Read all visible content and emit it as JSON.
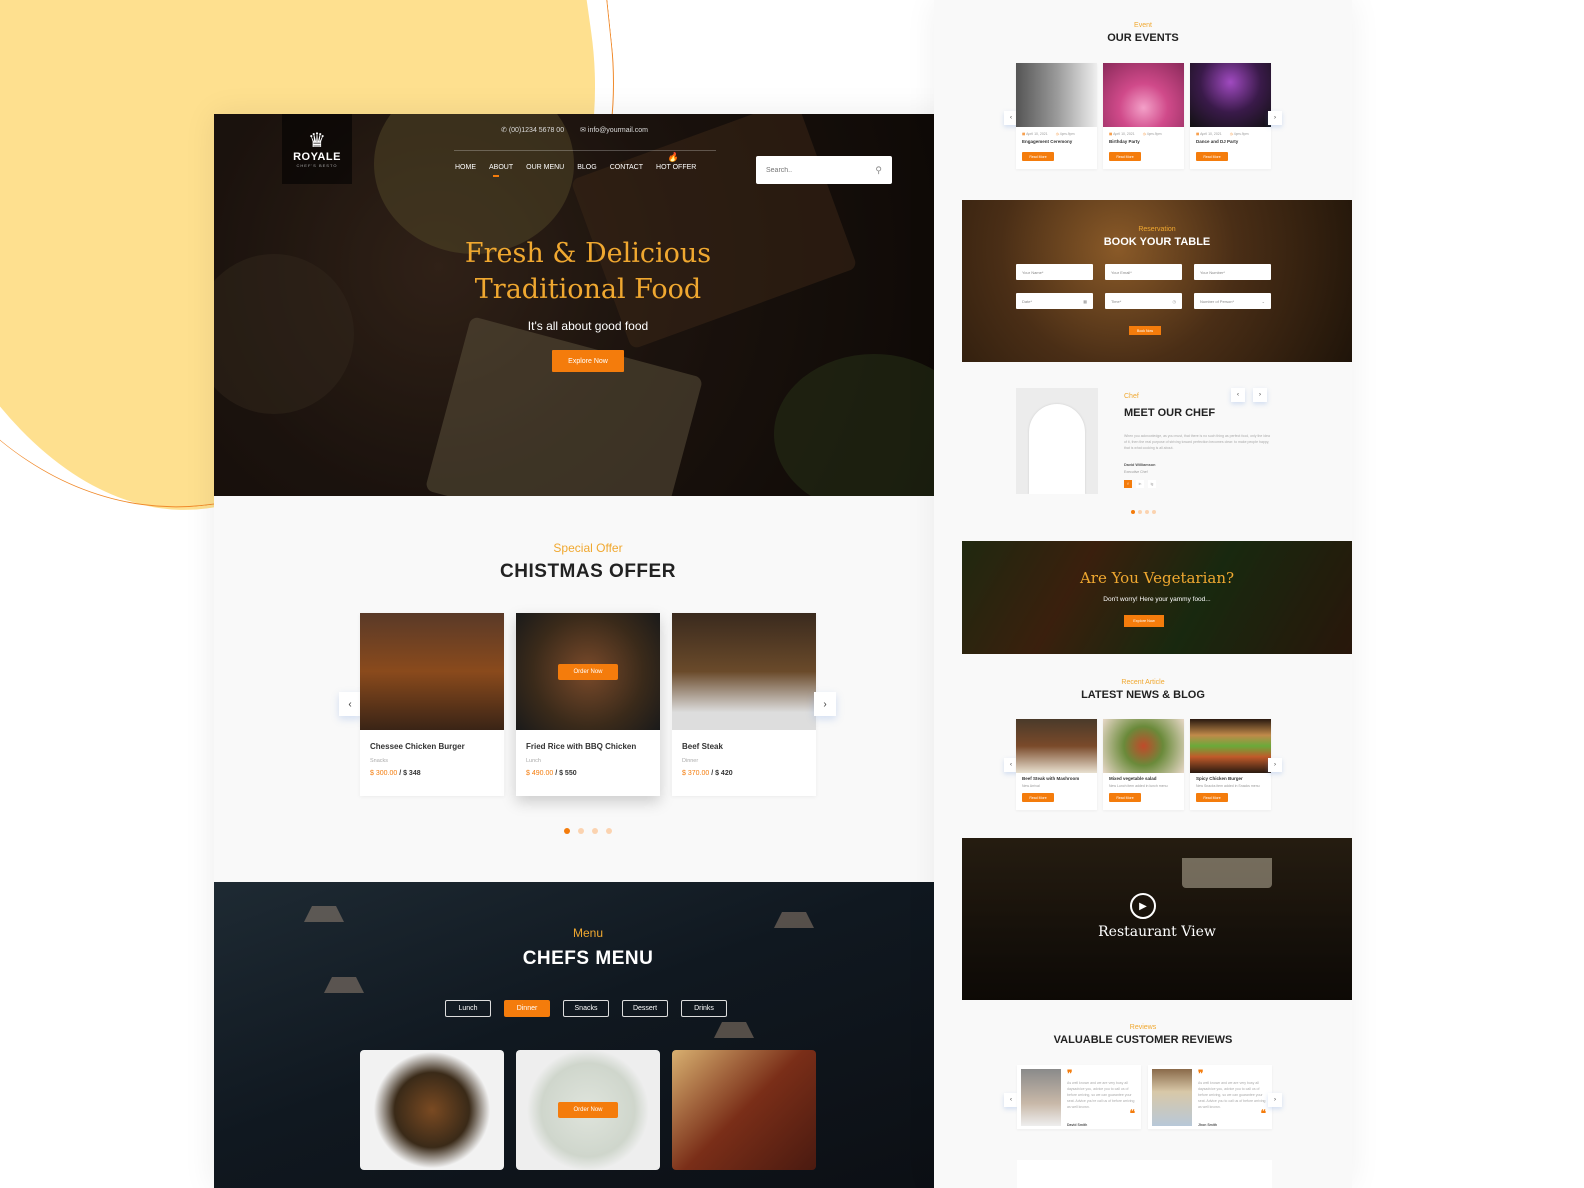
{
  "header": {
    "logo_name": "ROYALE",
    "logo_tagline": "CHEF'S BESTO",
    "phone": "(00)1234 5678 00",
    "email": "info@yourmail.com",
    "nav": [
      "HOME",
      "ABOUT",
      "OUR MENU",
      "BLOG",
      "CONTACT",
      "HOT OFFER"
    ],
    "active_nav": "ABOUT",
    "search_placeholder": "Search..",
    "icons": {
      "phone": "phone-icon",
      "email": "mail-icon",
      "search": "search-icon",
      "hot": "fire-icon"
    }
  },
  "hero": {
    "title_line1": "Fresh & Delicious",
    "title_line2": "Traditional Food",
    "subtitle": "It's all about good food",
    "cta": "Explore Now"
  },
  "offer": {
    "kicker": "Special Offer",
    "title": "CHISTMAS OFFER",
    "order_label": "Order Now",
    "items": [
      {
        "name": "Chessee Chicken Burger",
        "category": "Snacks",
        "price": "$ 300.00",
        "old_price": "$ 348"
      },
      {
        "name": "Fried Rice with BBQ Chicken",
        "category": "Lunch",
        "price": "$ 490.00",
        "old_price": "$ 550"
      },
      {
        "name": "Beef Steak",
        "category": "Dinner",
        "price": "$ 370.00",
        "old_price": "$ 420"
      }
    ],
    "pages": 4,
    "active_page": 1
  },
  "menu": {
    "kicker": "Menu",
    "title": "CHEFS MENU",
    "tabs": [
      "Lunch",
      "Dinner",
      "Snacks",
      "Dessert",
      "Drinks"
    ],
    "active_tab": "Dinner",
    "order_label": "Order Now"
  },
  "events": {
    "kicker": "Event",
    "title": "OUR EVENTS",
    "read_more": "Read More",
    "items": [
      {
        "name": "Engagement Ceremony",
        "date": "April 10, 2021",
        "time": "4pm-9pm"
      },
      {
        "name": "Birthday Party",
        "date": "April 10, 2021",
        "time": "4pm-9pm"
      },
      {
        "name": "Dance and DJ Party",
        "date": "April 10, 2021",
        "time": "4pm-9pm"
      }
    ]
  },
  "booking": {
    "kicker": "Reservation",
    "title": "BOOK YOUR TABLE",
    "fields": [
      "Your Name*",
      "Your Email*",
      "Your Number*",
      "Date*",
      "Time*",
      "Number of Person*"
    ],
    "submit": "Book Now"
  },
  "chef": {
    "kicker": "Chef",
    "title": "MEET OUR CHEF",
    "bio": "When you acknowledge, as you must, that there is no such thing as perfect food, only the idea of it, then the real purpose of striving toward perfection becomes clear: to make people happy, that is what cooking is all about.",
    "name": "David Williamson",
    "role": "Executive Chef",
    "social": [
      "f",
      "in",
      "ig"
    ]
  },
  "vegetarian": {
    "title": "Are You Vegetarian?",
    "subtitle": "Don't worry! Here your yammy food...",
    "cta": "Explore Now"
  },
  "blog": {
    "kicker": "Recent Article",
    "title": "LATEST NEWS & BLOG",
    "read_more": "Read More",
    "items": [
      {
        "title": "Beef Steak with Mashroom",
        "excerpt": "New Arrival"
      },
      {
        "title": "Mixed vegetable salad",
        "excerpt": "New Lunch item added in lunch menu"
      },
      {
        "title": "Spicy Chicken Burger",
        "excerpt": "New Snacks item added in Snacks menu"
      }
    ]
  },
  "restaurant_view": {
    "title": "Restaurant View"
  },
  "reviews": {
    "kicker": "Reviews",
    "title": "VALUABLE CUSTOMER REVIEWS",
    "items": [
      {
        "name": "David Smith",
        "text": "As well known and we are very busy all daysadvice you, advice you to call us of before arriving, so we can guarantee your seat. Advice you're call us of before arriving as well known."
      },
      {
        "name": "Jhon Smith",
        "text": "As well known and we are very busy all daysadvice you, advice you to call us of before arriving, so we can guarantee your seat. Advice you to call us of before arriving as well known."
      }
    ]
  },
  "colors": {
    "accent": "#f47c0c",
    "gold": "#f0a830",
    "blob": "#fee08f"
  }
}
